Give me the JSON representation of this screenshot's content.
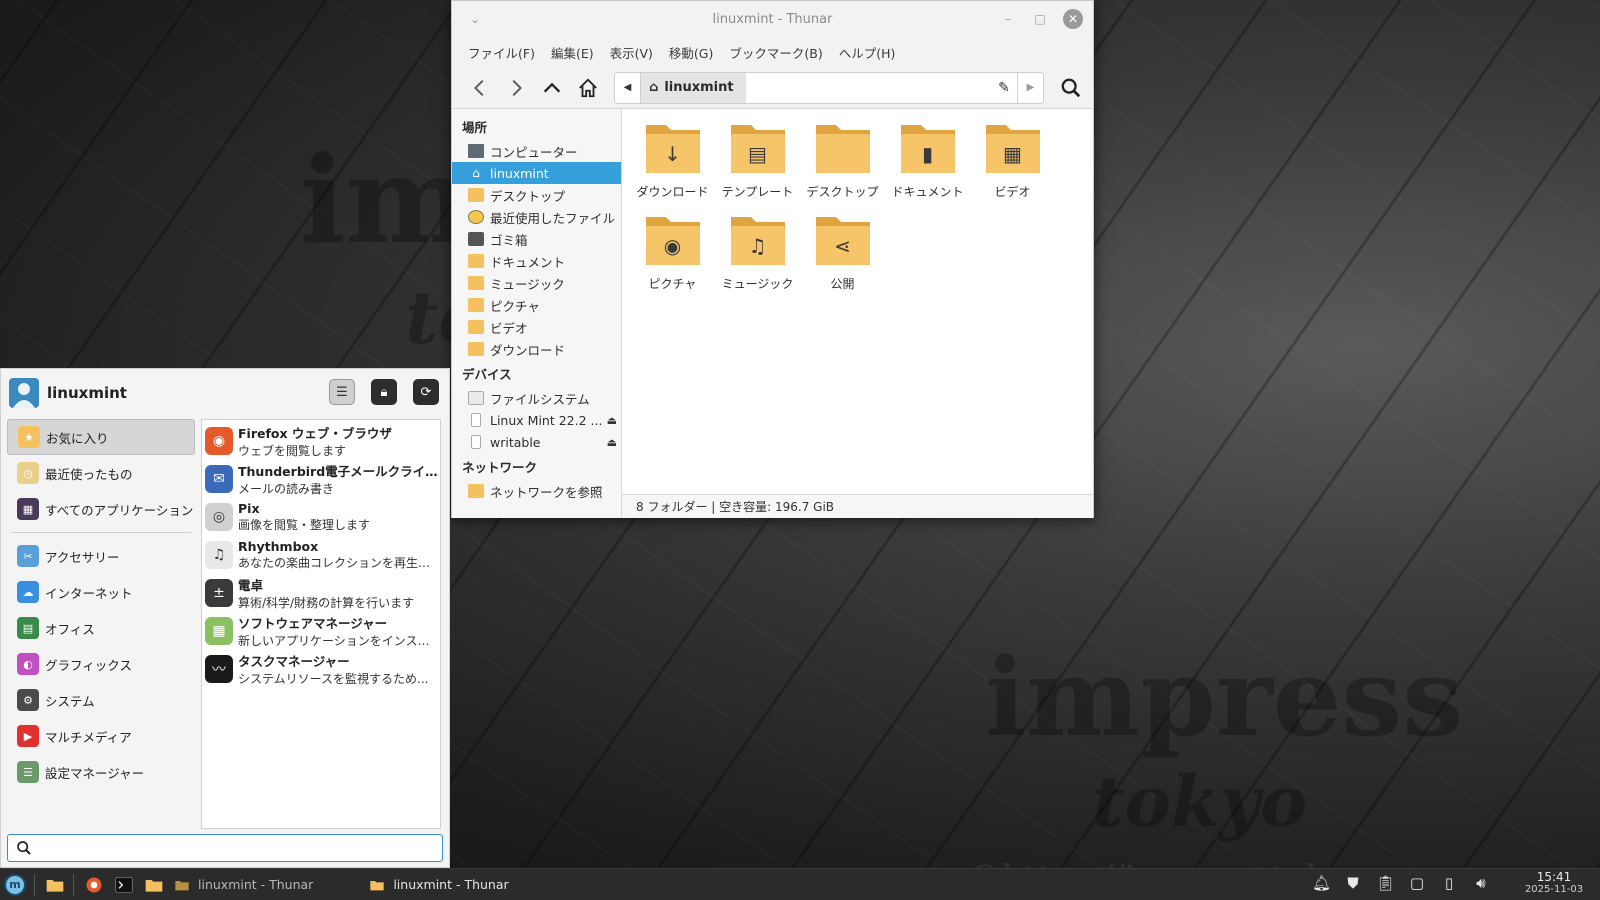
{
  "watermark": {
    "line1": "im",
    "line2": "to",
    "line3": "impress",
    "line4": "tokyo",
    "url": "©https://impress.tokyo"
  },
  "window": {
    "title": "linuxmint - Thunar",
    "menu": [
      "ファイル(F)",
      "編集(E)",
      "表示(V)",
      "移動(G)",
      "ブックマーク(B)",
      "ヘルプ(H)"
    ],
    "path": "linuxmint",
    "sidebar": {
      "places_header": "場所",
      "places": [
        {
          "label": "コンピューター",
          "icon": "computer-icon"
        },
        {
          "label": "linuxmint",
          "icon": "home-icon",
          "selected": true
        },
        {
          "label": "デスクトップ",
          "icon": "desktop-folder-icon"
        },
        {
          "label": "最近使用したファイル",
          "icon": "recent-icon"
        },
        {
          "label": "ゴミ箱",
          "icon": "trash-icon"
        },
        {
          "label": "ドキュメント",
          "icon": "documents-folder-icon"
        },
        {
          "label": "ミュージック",
          "icon": "music-folder-icon"
        },
        {
          "label": "ピクチャ",
          "icon": "pictures-folder-icon"
        },
        {
          "label": "ビデオ",
          "icon": "videos-folder-icon"
        },
        {
          "label": "ダウンロード",
          "icon": "downloads-folder-icon"
        }
      ],
      "devices_header": "デバイス",
      "devices": [
        {
          "label": "ファイルシステム",
          "icon": "filesystem-icon"
        },
        {
          "label": "Linux Mint 22.2 ...",
          "icon": "usb-drive-icon",
          "eject": true
        },
        {
          "label": "writable",
          "icon": "usb-drive-icon",
          "eject": true
        }
      ],
      "network_header": "ネットワーク",
      "network": [
        {
          "label": "ネットワークを参照",
          "icon": "network-folder-icon"
        }
      ]
    },
    "folders": [
      {
        "label": "ダウンロード",
        "glyph": "↓"
      },
      {
        "label": "テンプレート",
        "glyph": "▤"
      },
      {
        "label": "デスクトップ",
        "glyph": ""
      },
      {
        "label": "ドキュメント",
        "glyph": "▮"
      },
      {
        "label": "ビデオ",
        "glyph": "▦"
      },
      {
        "label": "ピクチャ",
        "glyph": "◉"
      },
      {
        "label": "ミュージック",
        "glyph": "♫"
      },
      {
        "label": "公開",
        "glyph": "⋖"
      }
    ],
    "status": "8 フォルダー  |  空き容量: 196.7 GiB"
  },
  "menu": {
    "username": "linuxmint",
    "categories_top": [
      {
        "label": "お気に入り",
        "color": "#f5c060",
        "glyph": "★",
        "selected": true
      },
      {
        "label": "最近使ったもの",
        "color": "#e8d08a",
        "glyph": "◷"
      },
      {
        "label": "すべてのアプリケーション",
        "color": "#4a3a5a",
        "glyph": "▦"
      }
    ],
    "categories": [
      {
        "label": "アクセサリー",
        "color": "#5aa0d8",
        "glyph": "✂"
      },
      {
        "label": "インターネット",
        "color": "#3a8ee0",
        "glyph": "☁"
      },
      {
        "label": "オフィス",
        "color": "#3a8a4a",
        "glyph": "▤"
      },
      {
        "label": "グラフィックス",
        "color": "#c050c0",
        "glyph": "◐"
      },
      {
        "label": "システム",
        "color": "#4a4a4a",
        "glyph": "⚙"
      },
      {
        "label": "マルチメディア",
        "color": "#e03030",
        "glyph": "▶"
      },
      {
        "label": "設定マネージャー",
        "color": "#6a9a6a",
        "glyph": "☰"
      }
    ],
    "apps": [
      {
        "name": "Firefox ウェブ・ブラウザ",
        "desc": "ウェブを閲覧します",
        "color": "#e55a2b",
        "glyph": "◉"
      },
      {
        "name": "Thunderbird電子メールクライア...",
        "desc": "メールの読み書き",
        "color": "#3a6ab8",
        "glyph": "✉"
      },
      {
        "name": "Pix",
        "desc": "画像を閲覧・整理します",
        "color": "#d0d0d0",
        "glyph": "◎"
      },
      {
        "name": "Rhythmbox",
        "desc": "あなたの楽曲コレクションを再生、...",
        "color": "#e8e8e8",
        "glyph": "♫"
      },
      {
        "name": "電卓",
        "desc": "算術/科学/財務の計算を行います",
        "color": "#3a3a3a",
        "glyph": "±"
      },
      {
        "name": "ソフトウェアマネージャー",
        "desc": "新しいアプリケーションをインスト...",
        "color": "#8ac060",
        "glyph": "▦"
      },
      {
        "name": "タスクマネージャー",
        "desc": "システムリソースを監視するため...",
        "color": "#1a1a1a",
        "glyph": "〰"
      }
    ],
    "search_placeholder": ""
  },
  "taskbar": {
    "tasks": [
      {
        "label": "linuxmint - Thunar"
      },
      {
        "label": "linuxmint - Thunar",
        "active": true
      }
    ],
    "time": "15:41",
    "date": "2025-11-03"
  }
}
